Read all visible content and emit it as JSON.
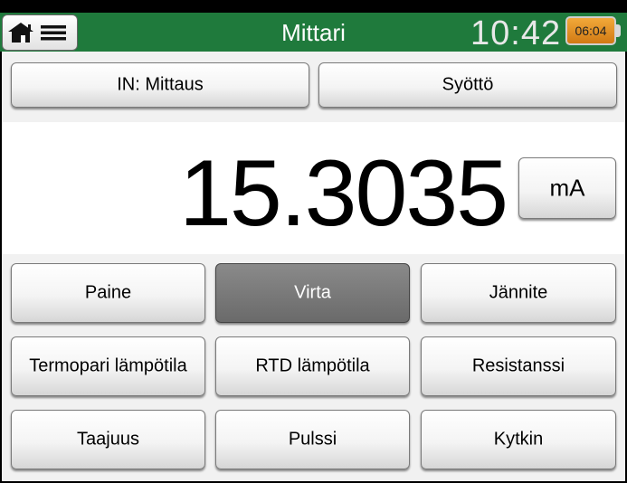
{
  "header": {
    "title": "Mittari",
    "time": "10:42",
    "battery_text": "06:04"
  },
  "top_buttons": [
    {
      "label": "IN: Mittaus"
    },
    {
      "label": "Syöttö"
    }
  ],
  "reading": {
    "value": "15.3035",
    "unit": "mA"
  },
  "quantities": [
    {
      "label": "Paine",
      "active": false
    },
    {
      "label": "Virta",
      "active": true
    },
    {
      "label": "Jännite",
      "active": false
    },
    {
      "label": "Termopari lämpötila",
      "active": false
    },
    {
      "label": "RTD lämpötila",
      "active": false
    },
    {
      "label": "Resistanssi",
      "active": false
    },
    {
      "label": "Taajuus",
      "active": false
    },
    {
      "label": "Pulssi",
      "active": false
    },
    {
      "label": "Kytkin",
      "active": false
    }
  ],
  "colors": {
    "header": "#1f7a3c",
    "active_button": "#6a6a6a",
    "battery": "#e8901e"
  }
}
